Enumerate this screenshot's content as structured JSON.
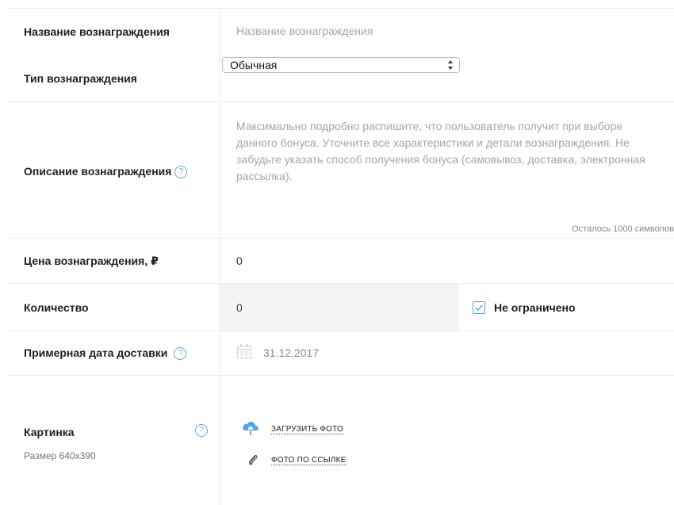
{
  "form": {
    "reward_name": {
      "label": "Название вознаграждения",
      "placeholder": "Название вознаграждения"
    },
    "reward_type": {
      "label": "Тип вознаграждения",
      "selected": "Обычная"
    },
    "description": {
      "label": "Описание вознаграждения",
      "help": "?",
      "placeholder": "Максимально подробно распишите, что пользователь получит при выборе данного бонуса. Уточните все характеристики и детали вознаграждения. Не забудьте указать способ получения бонуса (самовывоз, доставка, электронная рассылка).",
      "counter": "Осталось 1000 символов"
    },
    "price": {
      "label": "Цена вознаграждения, ₽",
      "value": "0"
    },
    "quantity": {
      "label": "Количество",
      "value": "0",
      "unlimited_label": "Не ограничено",
      "unlimited_checked": true
    },
    "delivery_date": {
      "label": "Примерная дата доставки",
      "help": "?",
      "value": "31.12.2017",
      "icon": "calendar-icon"
    },
    "image": {
      "label": "Картинка",
      "help": "?",
      "size_note": "Размер 640x390",
      "upload_label": "ЗАГРУЗИТЬ ФОТО",
      "upload_icon": "cloud-upload-icon",
      "link_label": "ФОТО ПО ССЫЛКЕ",
      "link_icon": "paperclip-icon"
    }
  },
  "colors": {
    "accent": "#4ea5e0",
    "border": "#ececec",
    "placeholder": "#a6a6a6"
  }
}
